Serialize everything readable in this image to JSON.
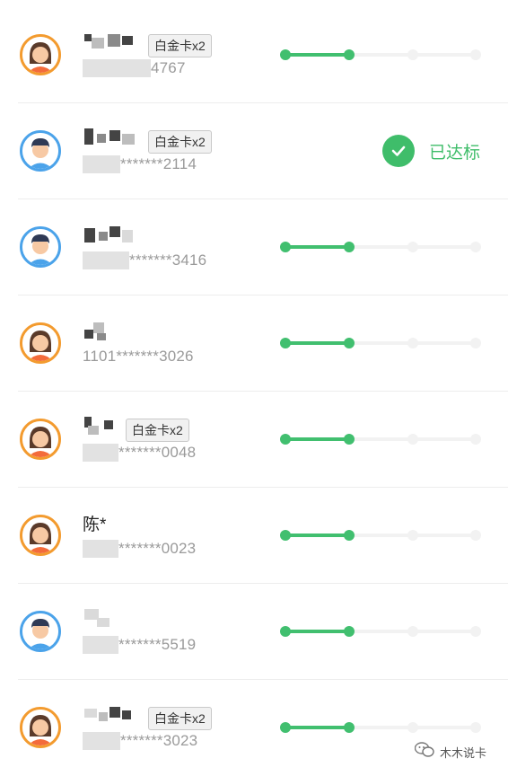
{
  "colors": {
    "accent": "#41bf6f",
    "female_ring": "#f39b2f",
    "male_ring": "#4ba3ea"
  },
  "members": [
    {
      "avatar": "female-avatar-icon",
      "name": "",
      "badge": "白金卡x2",
      "account": "4767",
      "status": "progress",
      "progress": 0.333
    },
    {
      "avatar": "male-avatar-icon",
      "name": "",
      "badge": "白金卡x2",
      "account": "*******2114",
      "status": "reached",
      "status_label": "已达标"
    },
    {
      "avatar": "male-avatar-icon",
      "name": "",
      "badge": "",
      "account": "*******3416",
      "status": "progress",
      "progress": 0.333
    },
    {
      "avatar": "female-avatar-icon",
      "name": "",
      "badge": "",
      "account": "1101*******3026",
      "status": "progress",
      "progress": 0.333
    },
    {
      "avatar": "female-avatar-icon",
      "name": "",
      "badge": "白金卡x2",
      "account": "*******0048",
      "status": "progress",
      "progress": 0.333
    },
    {
      "avatar": "female-avatar-icon",
      "name": "陈*",
      "badge": "",
      "account": "*******0023",
      "status": "progress",
      "progress": 0.333
    },
    {
      "avatar": "male-avatar-icon",
      "name": "",
      "badge": "",
      "account": "*******5519",
      "status": "progress",
      "progress": 0.333
    },
    {
      "avatar": "female-avatar-icon",
      "name": "",
      "badge": "白金卡x2",
      "account": "*******3023",
      "status": "progress",
      "progress": 0.333
    }
  ],
  "watermark": {
    "icon": "wechat-icon",
    "text": "木木说卡"
  }
}
